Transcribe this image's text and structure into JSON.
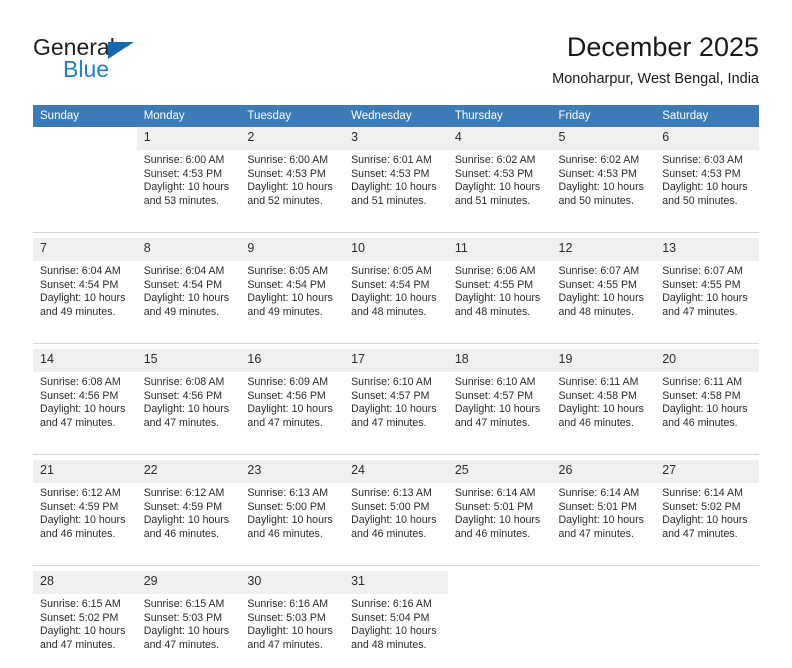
{
  "logo": {
    "word_one": "General",
    "word_two": "Blue",
    "triangle_icon": "triangle-icon",
    "accent_dark": "#231f20",
    "accent_blue": "#1b7fd4",
    "triangle_blue": "#1666b0"
  },
  "header": {
    "title": "December 2025",
    "subtitle": "Monoharpur, West Bengal, India"
  },
  "theme": {
    "header_bg": "#3b7cb8",
    "header_text": "#ffffff",
    "daynum_bg": "#f0f0f0",
    "cell_bg": "#ffffff",
    "separator": "#d4d4d4"
  },
  "weekdays": [
    "Sunday",
    "Monday",
    "Tuesday",
    "Wednesday",
    "Thursday",
    "Friday",
    "Saturday"
  ],
  "weeks": [
    [
      {
        "day": "",
        "lines": []
      },
      {
        "day": "1",
        "lines": [
          "Sunrise: 6:00 AM",
          "Sunset: 4:53 PM",
          "Daylight: 10 hours",
          "and 53 minutes."
        ]
      },
      {
        "day": "2",
        "lines": [
          "Sunrise: 6:00 AM",
          "Sunset: 4:53 PM",
          "Daylight: 10 hours",
          "and 52 minutes."
        ]
      },
      {
        "day": "3",
        "lines": [
          "Sunrise: 6:01 AM",
          "Sunset: 4:53 PM",
          "Daylight: 10 hours",
          "and 51 minutes."
        ]
      },
      {
        "day": "4",
        "lines": [
          "Sunrise: 6:02 AM",
          "Sunset: 4:53 PM",
          "Daylight: 10 hours",
          "and 51 minutes."
        ]
      },
      {
        "day": "5",
        "lines": [
          "Sunrise: 6:02 AM",
          "Sunset: 4:53 PM",
          "Daylight: 10 hours",
          "and 50 minutes."
        ]
      },
      {
        "day": "6",
        "lines": [
          "Sunrise: 6:03 AM",
          "Sunset: 4:53 PM",
          "Daylight: 10 hours",
          "and 50 minutes."
        ]
      }
    ],
    [
      {
        "day": "7",
        "lines": [
          "Sunrise: 6:04 AM",
          "Sunset: 4:54 PM",
          "Daylight: 10 hours",
          "and 49 minutes."
        ]
      },
      {
        "day": "8",
        "lines": [
          "Sunrise: 6:04 AM",
          "Sunset: 4:54 PM",
          "Daylight: 10 hours",
          "and 49 minutes."
        ]
      },
      {
        "day": "9",
        "lines": [
          "Sunrise: 6:05 AM",
          "Sunset: 4:54 PM",
          "Daylight: 10 hours",
          "and 49 minutes."
        ]
      },
      {
        "day": "10",
        "lines": [
          "Sunrise: 6:05 AM",
          "Sunset: 4:54 PM",
          "Daylight: 10 hours",
          "and 48 minutes."
        ]
      },
      {
        "day": "11",
        "lines": [
          "Sunrise: 6:06 AM",
          "Sunset: 4:55 PM",
          "Daylight: 10 hours",
          "and 48 minutes."
        ]
      },
      {
        "day": "12",
        "lines": [
          "Sunrise: 6:07 AM",
          "Sunset: 4:55 PM",
          "Daylight: 10 hours",
          "and 48 minutes."
        ]
      },
      {
        "day": "13",
        "lines": [
          "Sunrise: 6:07 AM",
          "Sunset: 4:55 PM",
          "Daylight: 10 hours",
          "and 47 minutes."
        ]
      }
    ],
    [
      {
        "day": "14",
        "lines": [
          "Sunrise: 6:08 AM",
          "Sunset: 4:56 PM",
          "Daylight: 10 hours",
          "and 47 minutes."
        ]
      },
      {
        "day": "15",
        "lines": [
          "Sunrise: 6:08 AM",
          "Sunset: 4:56 PM",
          "Daylight: 10 hours",
          "and 47 minutes."
        ]
      },
      {
        "day": "16",
        "lines": [
          "Sunrise: 6:09 AM",
          "Sunset: 4:56 PM",
          "Daylight: 10 hours",
          "and 47 minutes."
        ]
      },
      {
        "day": "17",
        "lines": [
          "Sunrise: 6:10 AM",
          "Sunset: 4:57 PM",
          "Daylight: 10 hours",
          "and 47 minutes."
        ]
      },
      {
        "day": "18",
        "lines": [
          "Sunrise: 6:10 AM",
          "Sunset: 4:57 PM",
          "Daylight: 10 hours",
          "and 47 minutes."
        ]
      },
      {
        "day": "19",
        "lines": [
          "Sunrise: 6:11 AM",
          "Sunset: 4:58 PM",
          "Daylight: 10 hours",
          "and 46 minutes."
        ]
      },
      {
        "day": "20",
        "lines": [
          "Sunrise: 6:11 AM",
          "Sunset: 4:58 PM",
          "Daylight: 10 hours",
          "and 46 minutes."
        ]
      }
    ],
    [
      {
        "day": "21",
        "lines": [
          "Sunrise: 6:12 AM",
          "Sunset: 4:59 PM",
          "Daylight: 10 hours",
          "and 46 minutes."
        ]
      },
      {
        "day": "22",
        "lines": [
          "Sunrise: 6:12 AM",
          "Sunset: 4:59 PM",
          "Daylight: 10 hours",
          "and 46 minutes."
        ]
      },
      {
        "day": "23",
        "lines": [
          "Sunrise: 6:13 AM",
          "Sunset: 5:00 PM",
          "Daylight: 10 hours",
          "and 46 minutes."
        ]
      },
      {
        "day": "24",
        "lines": [
          "Sunrise: 6:13 AM",
          "Sunset: 5:00 PM",
          "Daylight: 10 hours",
          "and 46 minutes."
        ]
      },
      {
        "day": "25",
        "lines": [
          "Sunrise: 6:14 AM",
          "Sunset: 5:01 PM",
          "Daylight: 10 hours",
          "and 46 minutes."
        ]
      },
      {
        "day": "26",
        "lines": [
          "Sunrise: 6:14 AM",
          "Sunset: 5:01 PM",
          "Daylight: 10 hours",
          "and 47 minutes."
        ]
      },
      {
        "day": "27",
        "lines": [
          "Sunrise: 6:14 AM",
          "Sunset: 5:02 PM",
          "Daylight: 10 hours",
          "and 47 minutes."
        ]
      }
    ],
    [
      {
        "day": "28",
        "lines": [
          "Sunrise: 6:15 AM",
          "Sunset: 5:02 PM",
          "Daylight: 10 hours",
          "and 47 minutes."
        ]
      },
      {
        "day": "29",
        "lines": [
          "Sunrise: 6:15 AM",
          "Sunset: 5:03 PM",
          "Daylight: 10 hours",
          "and 47 minutes."
        ]
      },
      {
        "day": "30",
        "lines": [
          "Sunrise: 6:16 AM",
          "Sunset: 5:03 PM",
          "Daylight: 10 hours",
          "and 47 minutes."
        ]
      },
      {
        "day": "31",
        "lines": [
          "Sunrise: 6:16 AM",
          "Sunset: 5:04 PM",
          "Daylight: 10 hours",
          "and 48 minutes."
        ]
      },
      {
        "day": "",
        "lines": []
      },
      {
        "day": "",
        "lines": []
      },
      {
        "day": "",
        "lines": []
      }
    ]
  ]
}
